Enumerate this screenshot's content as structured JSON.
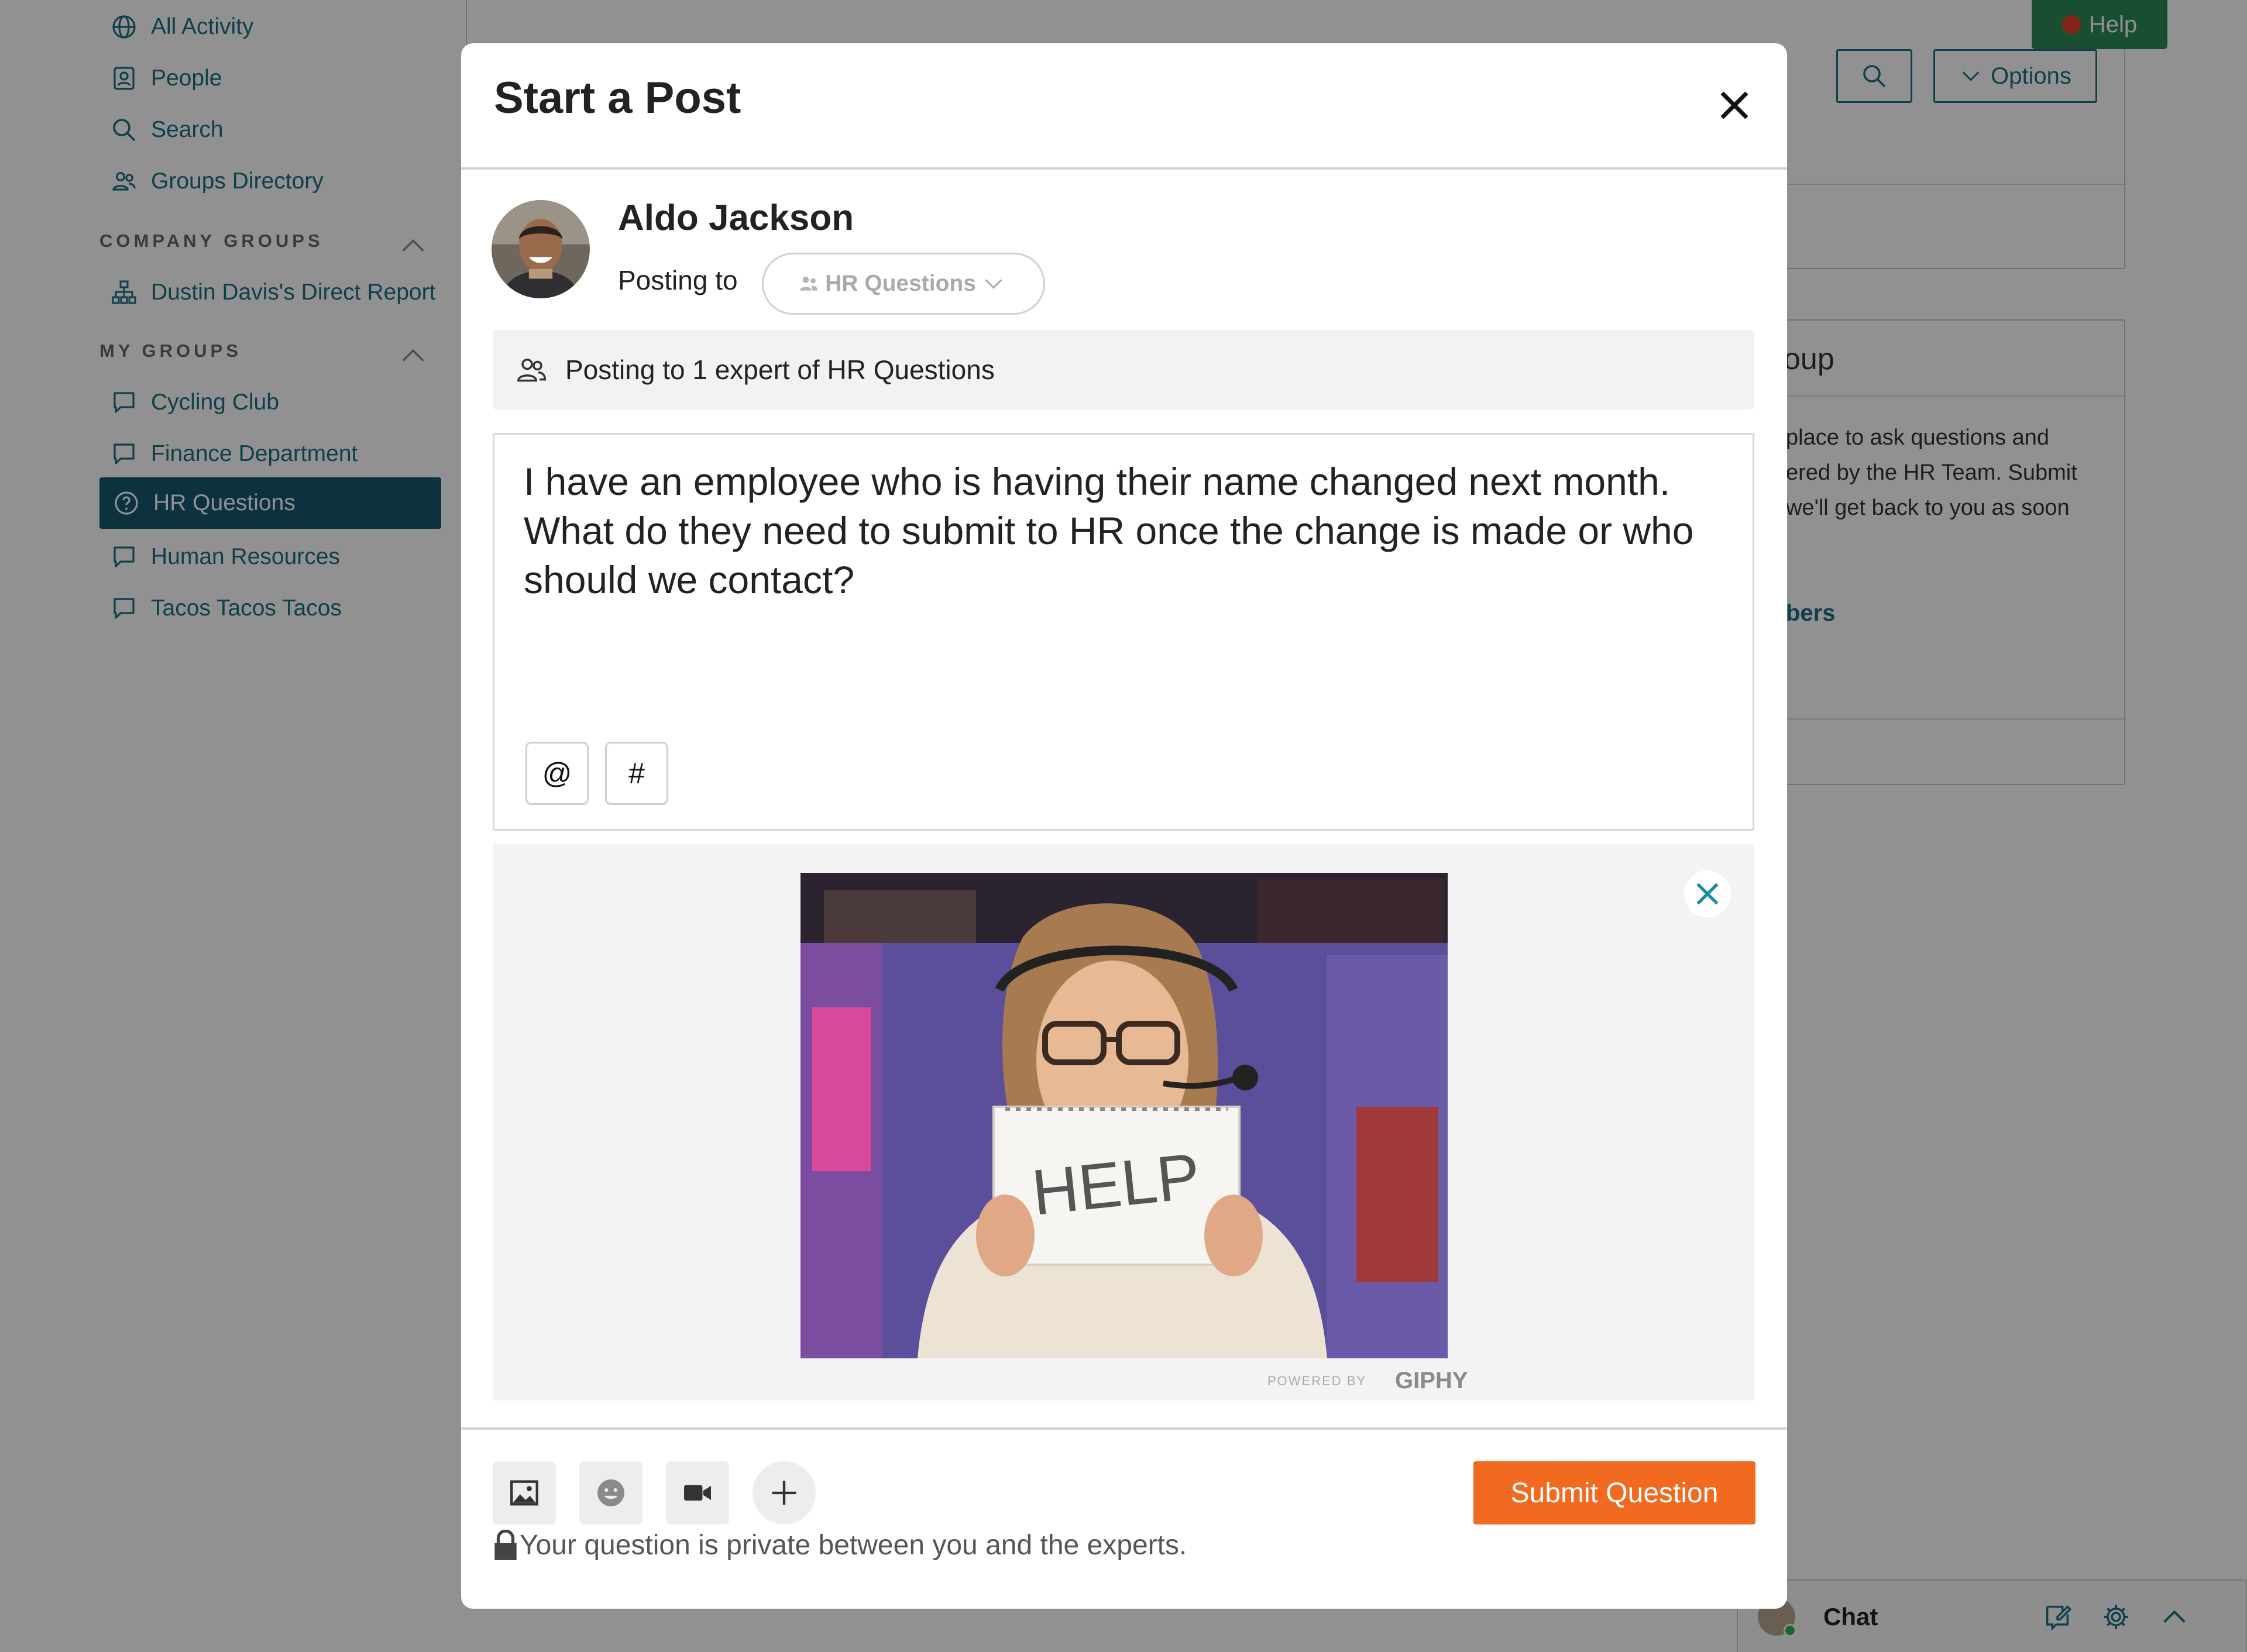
{
  "sidebar": {
    "items": [
      {
        "label": "All Activity",
        "icon": "globe-icon"
      },
      {
        "label": "People",
        "icon": "person-card-icon"
      },
      {
        "label": "Search",
        "icon": "search-icon"
      },
      {
        "label": "Groups Directory",
        "icon": "groups-icon"
      }
    ],
    "company_groups_heading": "COMPANY GROUPS",
    "company_groups": [
      {
        "label": "Dustin Davis's Direct Report",
        "icon": "org-chart-icon"
      }
    ],
    "my_groups_heading": "MY GROUPS",
    "my_groups": [
      {
        "label": "Cycling Club",
        "icon": "chat-bubble-icon"
      },
      {
        "label": "Finance Department",
        "icon": "chat-bubble-icon"
      },
      {
        "label": "HR Questions",
        "icon": "question-circle-icon",
        "active": true
      },
      {
        "label": "Human Resources",
        "icon": "chat-bubble-icon"
      },
      {
        "label": "Tacos Tacos Tacos",
        "icon": "chat-bubble-icon"
      }
    ]
  },
  "header": {
    "help_label": "Help",
    "options_label": "Options"
  },
  "right_panel": {
    "title_fragment": "oup",
    "description_lines": [
      "place to ask questions and",
      "ered by the HR Team. Submit",
      "we'll get back to you as soon"
    ],
    "members_link_fragment": "bers"
  },
  "chat": {
    "label": "Chat"
  },
  "modal": {
    "title": "Start a Post",
    "user_name": "Aldo Jackson",
    "posting_to_label": "Posting to",
    "group_selector": "HR Questions",
    "info_text": "Posting to 1 expert of HR Questions",
    "body_text": "I have an employee who is having their name changed next month. What do they need to submit to HR once the change is made or who should we contact?",
    "mention_button": "@",
    "hashtag_button": "#",
    "gif": {
      "sign_text": "HELP",
      "powered_by": "POWERED BY",
      "giphy": "GIPHY"
    },
    "submit_label": "Submit Question",
    "privacy_text": "Your question is private between you and the experts."
  },
  "colors": {
    "sidebar_link": "#1c6f86",
    "sidebar_active_bg": "#14586e",
    "help_green": "#2f8a5a",
    "submit_orange": "#f16a20",
    "overlay": "rgba(0,0,0,0.43)"
  }
}
